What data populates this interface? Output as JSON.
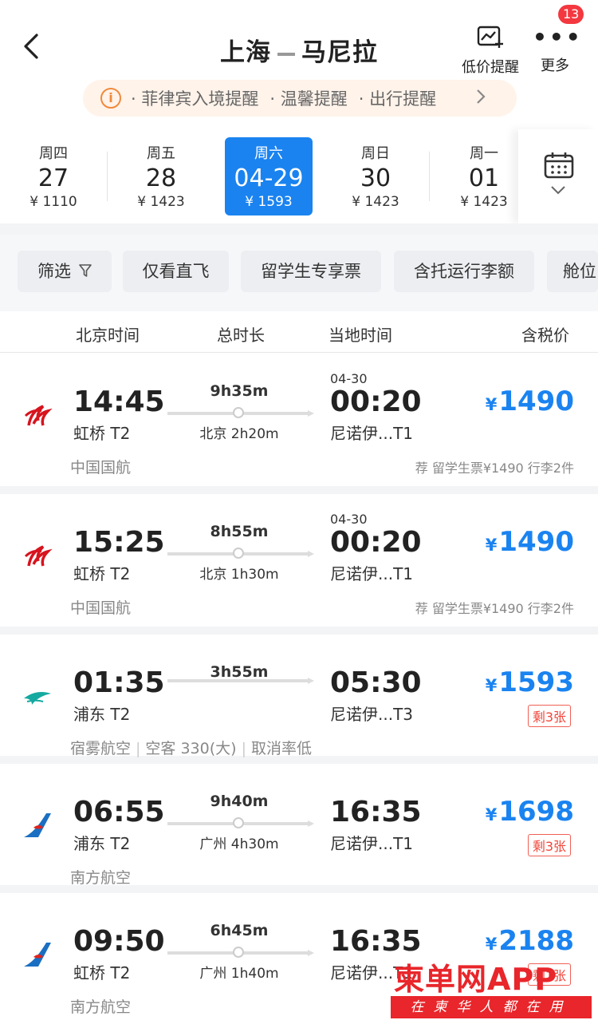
{
  "header": {
    "from": "上海",
    "to": "马尼拉",
    "price_alert_label": "低价提醒",
    "more_label": "更多",
    "badge_count": "13"
  },
  "notice": {
    "icon": "info-icon",
    "items": [
      "· 菲律宾入境提醒",
      "· 温馨提醒",
      "· 出行提醒"
    ]
  },
  "dates": [
    {
      "weekday": "周四",
      "day": "27",
      "price": "¥ 1110"
    },
    {
      "weekday": "周五",
      "day": "28",
      "price": "¥ 1423"
    },
    {
      "weekday": "周六",
      "day": "04-29",
      "price": "¥ 1593",
      "selected": true
    },
    {
      "weekday": "周日",
      "day": "30",
      "price": "¥ 1423"
    },
    {
      "weekday": "周一",
      "day": "01",
      "price": "¥ 1423"
    }
  ],
  "filters": [
    "筛选",
    "仅看直飞",
    "留学生专享票",
    "含托运行李额",
    "舱位"
  ],
  "columns": {
    "beijing_time": "北京时间",
    "duration": "总时长",
    "local_time": "当地时间",
    "price_incl_tax": "含税价"
  },
  "flights": [
    {
      "airline_icon": "air-china-logo",
      "dep_time": "14:45",
      "dep_airport": "虹桥 T2",
      "duration": "9h35m",
      "stop": "北京 2h20m",
      "arr_date": "04-30",
      "arr_time": "00:20",
      "arr_airport": "尼诺伊...T1",
      "currency": "¥",
      "price": "1490",
      "airline": "中国国航",
      "tag": "荐 留学生票¥1490 行李2件"
    },
    {
      "airline_icon": "air-china-logo",
      "dep_time": "15:25",
      "dep_airport": "虹桥 T2",
      "duration": "8h55m",
      "stop": "北京 1h30m",
      "arr_date": "04-30",
      "arr_time": "00:20",
      "arr_airport": "尼诺伊...T1",
      "currency": "¥",
      "price": "1490",
      "airline": "中国国航",
      "tag": "荐 留学生票¥1490 行李2件"
    },
    {
      "airline_icon": "xiamen-airlines-logo",
      "dep_time": "01:35",
      "dep_airport": "浦东 T2",
      "duration": "3h55m",
      "stop": "",
      "arr_date": "",
      "arr_time": "05:30",
      "arr_airport": "尼诺伊...T3",
      "currency": "¥",
      "price": "1593",
      "remaining": "剩3张",
      "airline": "宿雾航空",
      "aircraft": "空客 330(大)",
      "note": "取消率低"
    },
    {
      "airline_icon": "china-southern-logo",
      "dep_time": "06:55",
      "dep_airport": "浦东 T2",
      "duration": "9h40m",
      "stop": "广州 4h30m",
      "arr_date": "",
      "arr_time": "16:35",
      "arr_airport": "尼诺伊...T1",
      "currency": "¥",
      "price": "1698",
      "remaining": "剩3张",
      "airline": "南方航空"
    },
    {
      "airline_icon": "china-southern-logo",
      "dep_time": "09:50",
      "dep_airport": "虹桥 T2",
      "duration": "6h45m",
      "stop": "广州 1h40m",
      "arr_date": "",
      "arr_time": "16:35",
      "arr_airport": "尼诺伊...T1",
      "currency": "¥",
      "price": "2188",
      "remaining": "剩1张",
      "airline": "南方航空"
    }
  ],
  "watermark": {
    "brand": "柬单网APP",
    "slogan": "在柬华人都在用"
  },
  "colors": {
    "accent_blue": "#1a83f0",
    "air_china_red": "#d7141e",
    "xiamen_teal": "#16a9a0",
    "china_southern_blue": "#1b6fc2",
    "warning_red": "#f0453a"
  }
}
